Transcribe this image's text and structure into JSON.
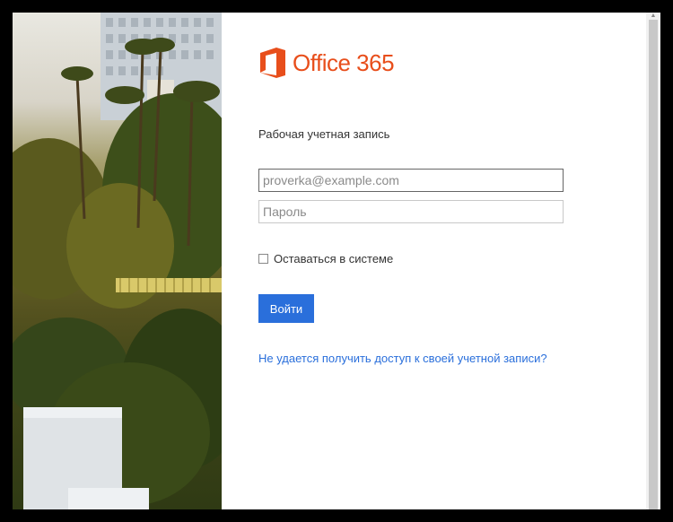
{
  "brand": {
    "name": "Office 365",
    "accent": "#e84e1b"
  },
  "login": {
    "heading": "Рабочая учетная запись",
    "email_placeholder": "proverka@example.com",
    "password_placeholder": "Пароль",
    "remember_label": "Оставаться в системе",
    "signin_label": "Войти",
    "help_link": "Не удается получить доступ к своей учетной записи?"
  },
  "colors": {
    "button": "#2a6fdb",
    "link": "#2a6fdb"
  }
}
